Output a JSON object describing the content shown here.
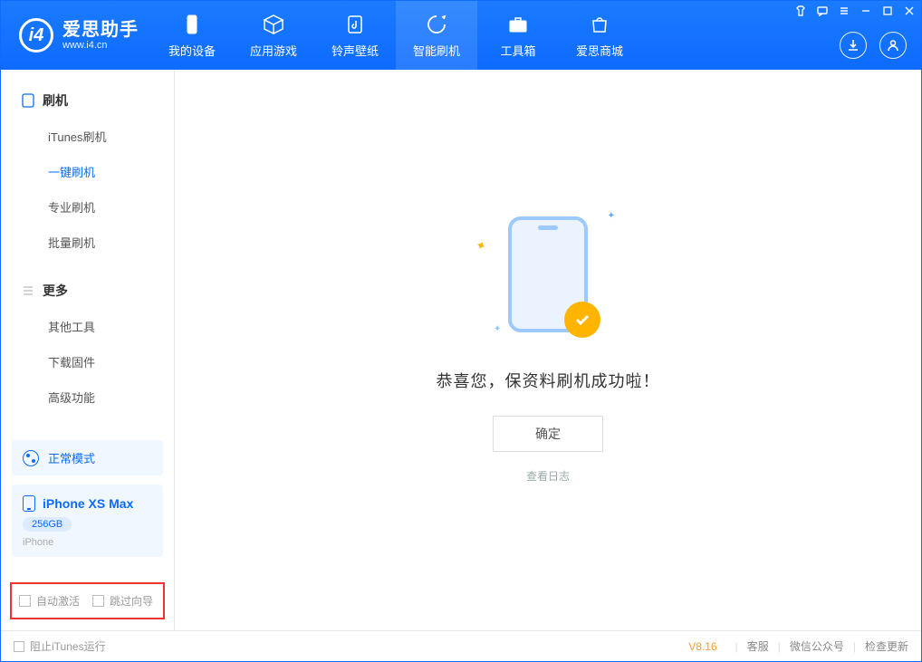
{
  "brand": {
    "name": "爱思助手",
    "url": "www.i4.cn"
  },
  "nav": {
    "my_device": "我的设备",
    "apps_games": "应用游戏",
    "ringtones": "铃声壁纸",
    "smart_flash": "智能刷机",
    "toolbox": "工具箱",
    "store": "爱思商城"
  },
  "sidebar": {
    "section_flash": "刷机",
    "items_flash": [
      "iTunes刷机",
      "一键刷机",
      "专业刷机",
      "批量刷机"
    ],
    "section_more": "更多",
    "items_more": [
      "其他工具",
      "下载固件",
      "高级功能"
    ]
  },
  "mode_label": "正常模式",
  "device": {
    "name": "iPhone XS Max",
    "capacity": "256GB",
    "type": "iPhone"
  },
  "options": {
    "auto_activate": "自动激活",
    "skip_wizard": "跳过向导"
  },
  "result": {
    "success_text": "恭喜您，保资料刷机成功啦！",
    "ok_button": "确定",
    "view_log": "查看日志"
  },
  "status": {
    "block_itunes": "阻止iTunes运行",
    "version": "V8.16",
    "support": "客服",
    "wechat": "微信公众号",
    "check_update": "检查更新"
  }
}
